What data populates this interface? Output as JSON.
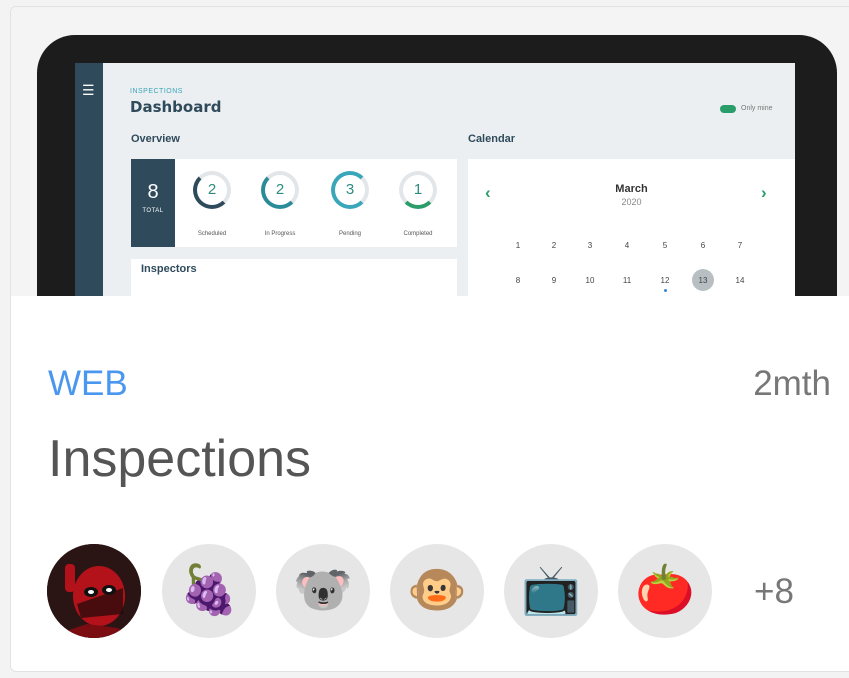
{
  "preview": {
    "section_label": "INSPECTIONS",
    "title": "Dashboard",
    "toggle_label": "Only mine",
    "overview": {
      "label": "Overview",
      "total_value": "8",
      "total_label": "TOTAL",
      "stats": [
        {
          "value": "2",
          "label": "Scheduled"
        },
        {
          "value": "2",
          "label": "In Progress"
        },
        {
          "value": "3",
          "label": "Pending"
        },
        {
          "value": "1",
          "label": "Completed"
        }
      ]
    },
    "inspectors_label": "Inspectors",
    "calendar": {
      "label": "Calendar",
      "month": "March",
      "year": "2020",
      "prev_icon": "chevron-left-icon",
      "next_icon": "chevron-right-icon",
      "row1": [
        "1",
        "2",
        "3",
        "4",
        "5",
        "6",
        "7"
      ],
      "row2": [
        "8",
        "9",
        "10",
        "11",
        "12",
        "13",
        "14"
      ],
      "today": "13"
    }
  },
  "card": {
    "platform": "WEB",
    "age": "2mth",
    "title": "Inspections",
    "avatars": [
      {
        "icon": "deadpool-avatar"
      },
      {
        "icon": "grapes-icon",
        "glyph": "🍇"
      },
      {
        "icon": "koala-icon",
        "glyph": "🐨"
      },
      {
        "icon": "monkey-icon",
        "glyph": "🐵"
      },
      {
        "icon": "television-icon",
        "glyph": "📺"
      },
      {
        "icon": "tomato-icon",
        "glyph": "🍅"
      }
    ],
    "more_count": "+8"
  },
  "colors": {
    "accent_blue": "#4a97ef",
    "sidebar": "#2e4a5b",
    "toggle": "#2a9d6a"
  }
}
